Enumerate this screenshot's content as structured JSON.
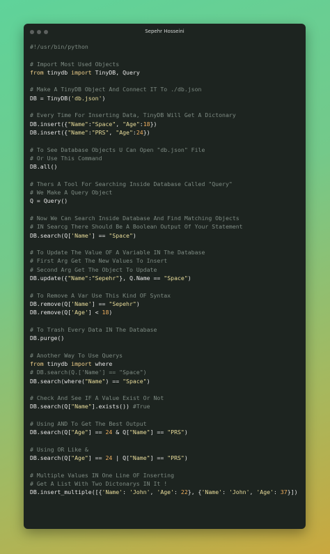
{
  "window": {
    "title": "Sepehr Hosseini"
  },
  "colors": {
    "comment": "#7d8a82",
    "keyword": "#f0d08a",
    "string": "#e8dc9a",
    "number": "#f0b060",
    "plain": "#e6e6e6",
    "background": "#1d2420"
  },
  "lines": [
    [
      {
        "t": "c",
        "v": "#!/usr/bin/python"
      }
    ],
    [],
    [
      {
        "t": "c",
        "v": "# Import Most Used Objects"
      }
    ],
    [
      {
        "t": "k",
        "v": "from"
      },
      {
        "t": "p",
        "v": " tinydb "
      },
      {
        "t": "k",
        "v": "import"
      },
      {
        "t": "p",
        "v": " TinyDB, Query"
      }
    ],
    [],
    [
      {
        "t": "c",
        "v": "# Make A TinyDB Object And Connect IT To ./db.json"
      }
    ],
    [
      {
        "t": "p",
        "v": "DB = TinyDB("
      },
      {
        "t": "s",
        "v": "'db.json'"
      },
      {
        "t": "p",
        "v": ")"
      }
    ],
    [],
    [
      {
        "t": "c",
        "v": "# Every Time For Inserting Data, TinyDB Will Get A Dictonary"
      }
    ],
    [
      {
        "t": "p",
        "v": "DB.insert({"
      },
      {
        "t": "s",
        "v": "\"Name\""
      },
      {
        "t": "p",
        "v": ":"
      },
      {
        "t": "s",
        "v": "\"Space\""
      },
      {
        "t": "p",
        "v": ", "
      },
      {
        "t": "s",
        "v": "\"Age\""
      },
      {
        "t": "p",
        "v": ":"
      },
      {
        "t": "n",
        "v": "18"
      },
      {
        "t": "p",
        "v": "})"
      }
    ],
    [
      {
        "t": "p",
        "v": "DB.insert({"
      },
      {
        "t": "s",
        "v": "\"Name\""
      },
      {
        "t": "p",
        "v": ":"
      },
      {
        "t": "s",
        "v": "\"PRS\""
      },
      {
        "t": "p",
        "v": ", "
      },
      {
        "t": "s",
        "v": "\"Age\""
      },
      {
        "t": "p",
        "v": ":"
      },
      {
        "t": "n",
        "v": "24"
      },
      {
        "t": "p",
        "v": "})"
      }
    ],
    [],
    [
      {
        "t": "c",
        "v": "# To See Database Objects U Can Open \"db.json\" File"
      }
    ],
    [
      {
        "t": "c",
        "v": "# Or Use This Command"
      }
    ],
    [
      {
        "t": "p",
        "v": "DB.all()"
      }
    ],
    [],
    [
      {
        "t": "c",
        "v": "# Thers A Tool For Searching Inside Database Called \"Query\""
      }
    ],
    [
      {
        "t": "c",
        "v": "# We Make A Query Object"
      }
    ],
    [
      {
        "t": "p",
        "v": "Q = Query()"
      }
    ],
    [],
    [
      {
        "t": "c",
        "v": "# Now We Can Search Inside Database And Find Matching Objects"
      }
    ],
    [
      {
        "t": "c",
        "v": "# IN Searcg There Should Be A Boolean Output Of Your Statement"
      }
    ],
    [
      {
        "t": "p",
        "v": "DB.search(Q["
      },
      {
        "t": "s",
        "v": "'Name'"
      },
      {
        "t": "p",
        "v": "] == "
      },
      {
        "t": "s",
        "v": "\"Space\""
      },
      {
        "t": "p",
        "v": ")"
      }
    ],
    [],
    [
      {
        "t": "c",
        "v": "# To Update The Value OF A Variable IN The Database"
      }
    ],
    [
      {
        "t": "c",
        "v": "# First Arg Get The New Values To Insert"
      }
    ],
    [
      {
        "t": "c",
        "v": "# Second Arg Get The Object To Update"
      }
    ],
    [
      {
        "t": "p",
        "v": "DB.update({"
      },
      {
        "t": "s",
        "v": "\"Name\""
      },
      {
        "t": "p",
        "v": ":"
      },
      {
        "t": "s",
        "v": "\"Sepehr\""
      },
      {
        "t": "p",
        "v": "}, Q.Name == "
      },
      {
        "t": "s",
        "v": "\"Space\""
      },
      {
        "t": "p",
        "v": ")"
      }
    ],
    [],
    [
      {
        "t": "c",
        "v": "# To Remove A Var Use This Kind OF Syntax"
      }
    ],
    [
      {
        "t": "p",
        "v": "DB.remove(Q["
      },
      {
        "t": "s",
        "v": "'Name'"
      },
      {
        "t": "p",
        "v": "] == "
      },
      {
        "t": "s",
        "v": "\"Sepehr\""
      },
      {
        "t": "p",
        "v": ")"
      }
    ],
    [
      {
        "t": "p",
        "v": "DB.remove(Q["
      },
      {
        "t": "s",
        "v": "'Age'"
      },
      {
        "t": "p",
        "v": "] < "
      },
      {
        "t": "n",
        "v": "18"
      },
      {
        "t": "p",
        "v": ")"
      }
    ],
    [],
    [
      {
        "t": "c",
        "v": "# To Trash Every Data IN The Database"
      }
    ],
    [
      {
        "t": "p",
        "v": "DB.purge()"
      }
    ],
    [],
    [
      {
        "t": "c",
        "v": "# Another Way To Use Querys"
      }
    ],
    [
      {
        "t": "k",
        "v": "from"
      },
      {
        "t": "p",
        "v": " tinydb "
      },
      {
        "t": "k",
        "v": "import"
      },
      {
        "t": "p",
        "v": " where"
      }
    ],
    [
      {
        "t": "c",
        "v": "# DB.search(Q.['Name'] == \"Space\")"
      }
    ],
    [
      {
        "t": "p",
        "v": "DB.search(where("
      },
      {
        "t": "s",
        "v": "\"Name\""
      },
      {
        "t": "p",
        "v": ") == "
      },
      {
        "t": "s",
        "v": "\"Space\""
      },
      {
        "t": "p",
        "v": ")"
      }
    ],
    [],
    [
      {
        "t": "c",
        "v": "# Check And See IF A Value Exist Or Not"
      }
    ],
    [
      {
        "t": "p",
        "v": "DB.search(Q["
      },
      {
        "t": "s",
        "v": "\"Name\""
      },
      {
        "t": "p",
        "v": "].exists()) "
      },
      {
        "t": "c",
        "v": "#True"
      }
    ],
    [],
    [
      {
        "t": "c",
        "v": "# Using AND To Get The Best Output"
      }
    ],
    [
      {
        "t": "p",
        "v": "DB.search(Q["
      },
      {
        "t": "s",
        "v": "\"Age\""
      },
      {
        "t": "p",
        "v": "] == "
      },
      {
        "t": "n",
        "v": "24"
      },
      {
        "t": "p",
        "v": " & Q["
      },
      {
        "t": "s",
        "v": "\"Name\""
      },
      {
        "t": "p",
        "v": "] == "
      },
      {
        "t": "s",
        "v": "\"PRS\""
      },
      {
        "t": "p",
        "v": ")"
      }
    ],
    [],
    [
      {
        "t": "c",
        "v": "# Using OR Like &"
      }
    ],
    [
      {
        "t": "p",
        "v": "DB.search(Q["
      },
      {
        "t": "s",
        "v": "\"Age\""
      },
      {
        "t": "p",
        "v": "] == "
      },
      {
        "t": "n",
        "v": "24"
      },
      {
        "t": "p",
        "v": " | Q["
      },
      {
        "t": "s",
        "v": "\"Name\""
      },
      {
        "t": "p",
        "v": "] == "
      },
      {
        "t": "s",
        "v": "\"PRS\""
      },
      {
        "t": "p",
        "v": ")"
      }
    ],
    [],
    [
      {
        "t": "c",
        "v": "# Multiple Values IN One Line OF Inserting"
      }
    ],
    [
      {
        "t": "c",
        "v": "# Get A List With Two Dictonarys IN It !"
      }
    ],
    [
      {
        "t": "p",
        "v": "DB.insert_multiple([{"
      },
      {
        "t": "s",
        "v": "'Name'"
      },
      {
        "t": "p",
        "v": ": "
      },
      {
        "t": "s",
        "v": "'John'"
      },
      {
        "t": "p",
        "v": ", "
      },
      {
        "t": "s",
        "v": "'Age'"
      },
      {
        "t": "p",
        "v": ": "
      },
      {
        "t": "n",
        "v": "22"
      },
      {
        "t": "p",
        "v": "}, {"
      },
      {
        "t": "s",
        "v": "'Name'"
      },
      {
        "t": "p",
        "v": ": "
      },
      {
        "t": "s",
        "v": "'John'"
      },
      {
        "t": "p",
        "v": ", "
      },
      {
        "t": "s",
        "v": "'Age'"
      },
      {
        "t": "p",
        "v": ": "
      },
      {
        "t": "n",
        "v": "37"
      },
      {
        "t": "p",
        "v": "}])"
      }
    ]
  ]
}
